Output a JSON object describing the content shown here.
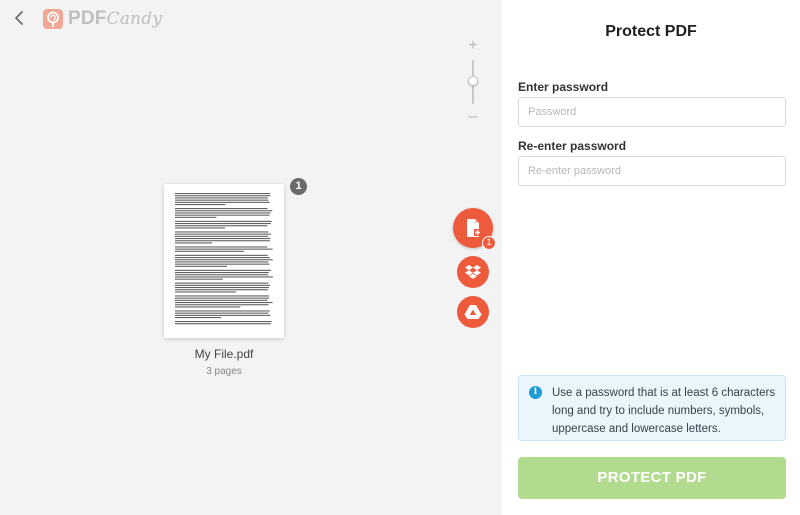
{
  "app": {
    "brand_pdf": "PDF",
    "brand_candy": "Candy",
    "brand_color": "#ed5b3c"
  },
  "nav": {
    "back_icon": "chevron-left-icon"
  },
  "zoom": {
    "plus": "+",
    "minus": "–",
    "level": 0.5
  },
  "file": {
    "name": "My File.pdf",
    "pages": "3 pages",
    "count_badge": "1"
  },
  "actions": {
    "add_file_badge": "1",
    "add_file_icon": "file-plus-icon",
    "dropbox_icon": "dropbox-icon",
    "drive_icon": "google-drive-icon"
  },
  "panel": {
    "title": "Protect PDF",
    "password_label": "Enter password",
    "password_placeholder": "Password",
    "reenter_label": "Re-enter password",
    "reenter_placeholder": "Re-enter password",
    "info_text": "Use a password that is at least 6 characters long and try to include numbers, symbols, uppercase and lowercase letters.",
    "button_label": "PROTECT PDF",
    "button_color": "#b2db8f",
    "info_color": "#1e9ad6"
  }
}
